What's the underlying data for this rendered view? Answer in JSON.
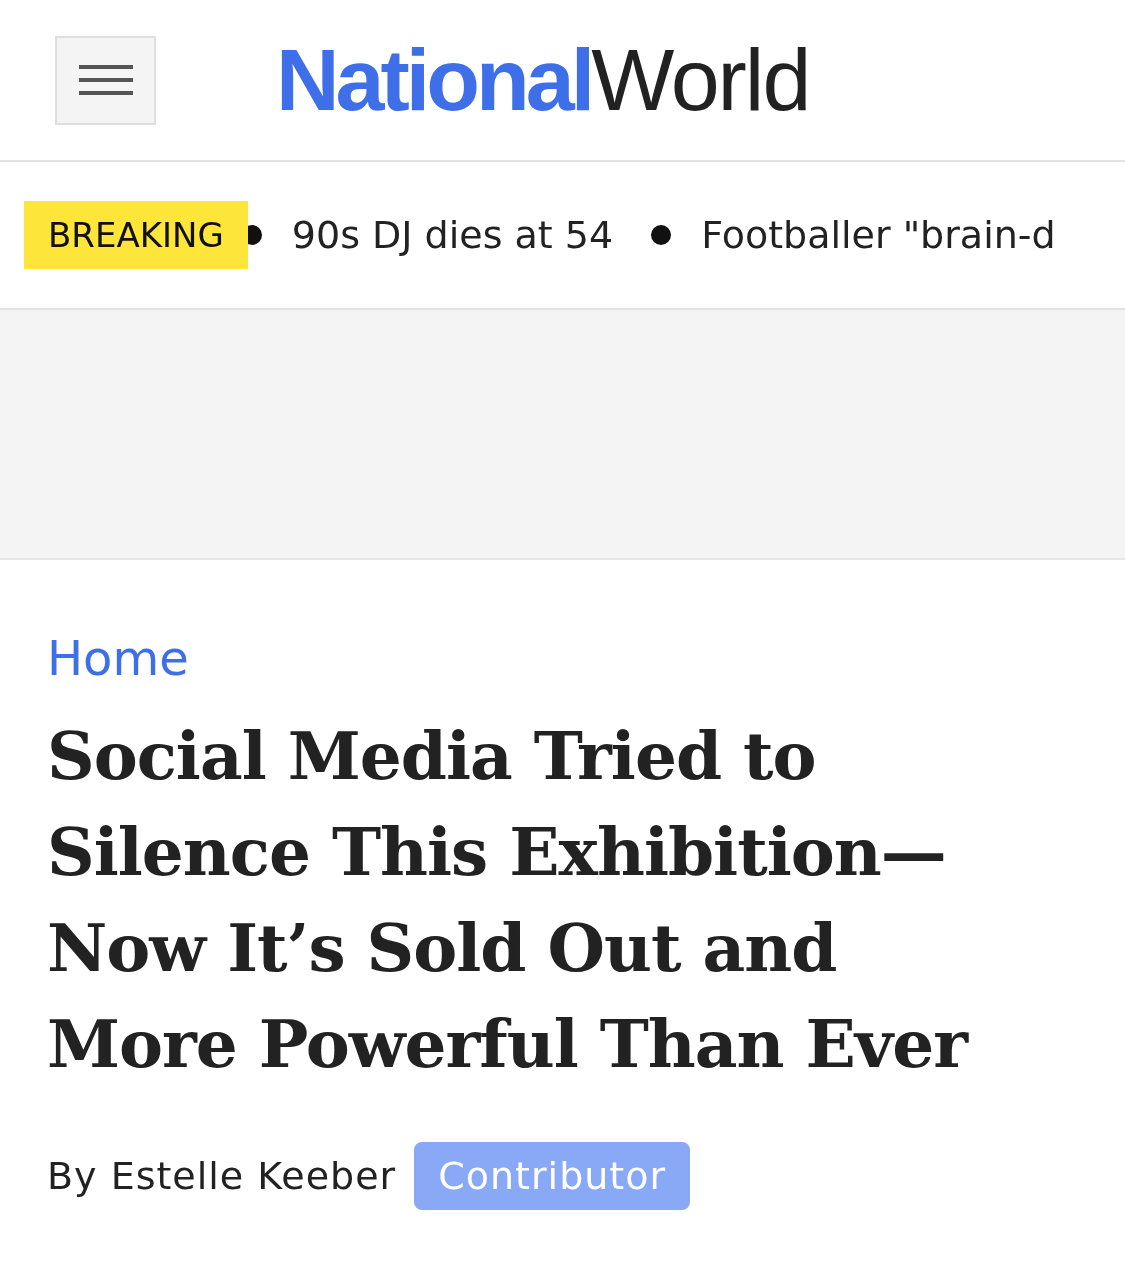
{
  "header": {
    "logo": {
      "bold": "National",
      "light": "World"
    }
  },
  "ticker": {
    "badge": "BREAKING",
    "items": [
      "90s DJ dies at 54",
      "Footballer \"brain-d"
    ]
  },
  "breadcrumb": "Home",
  "headline": "Social Media Tried to Silence This Exhibition—Now It’s Sold Out and More Powerful Than Ever",
  "byline": {
    "author": "By Estelle Keeber",
    "role": "Contributor"
  }
}
